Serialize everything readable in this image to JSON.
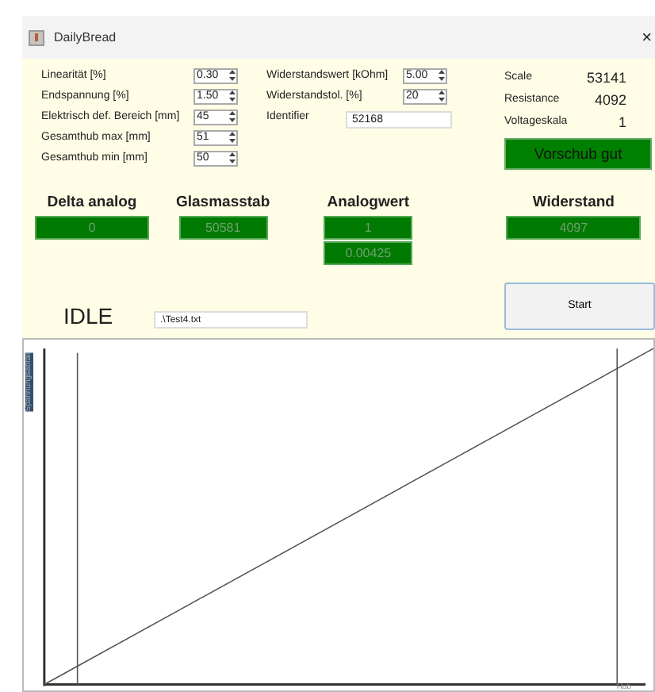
{
  "window": {
    "title": "DailyBread",
    "close": "×"
  },
  "params_left": [
    {
      "label": "Linearität [%]",
      "value": "0.30"
    },
    {
      "label": "Endspannung [%]",
      "value": "1.50"
    },
    {
      "label": "Elektrisch def. Bereich [mm]",
      "value": "45"
    },
    {
      "label": "Gesamthub max [mm]",
      "value": "51"
    },
    {
      "label": "Gesamthub min [mm]",
      "value": "50"
    }
  ],
  "params_middle": [
    {
      "label": "Widerstandswert [kOhm]",
      "value": "5.00"
    },
    {
      "label": "Widerstandstol. [%]",
      "value": "20"
    }
  ],
  "identifier": {
    "label": "Identifier",
    "value": "52168"
  },
  "readouts": [
    {
      "label": "Scale",
      "value": "53141"
    },
    {
      "label": "Resistance",
      "value": "4092"
    },
    {
      "label": "Voltageskala",
      "value": "1"
    }
  ],
  "status_button": "Vorschub gut",
  "displays": [
    {
      "title": "Delta analog",
      "values": [
        "0"
      ]
    },
    {
      "title": "Glasmasstab",
      "values": [
        "50581"
      ]
    },
    {
      "title": "Analogwert",
      "values": [
        "1",
        "0.00425"
      ]
    },
    {
      "title": "Widerstand",
      "values": [
        "4097"
      ]
    }
  ],
  "state": "IDLE",
  "file_field": {
    "value": ".\\Test4.txt"
  },
  "start_button": "Start",
  "chart": {
    "ylabel": "Spannungsabfall",
    "xlabel": "Hub"
  }
}
